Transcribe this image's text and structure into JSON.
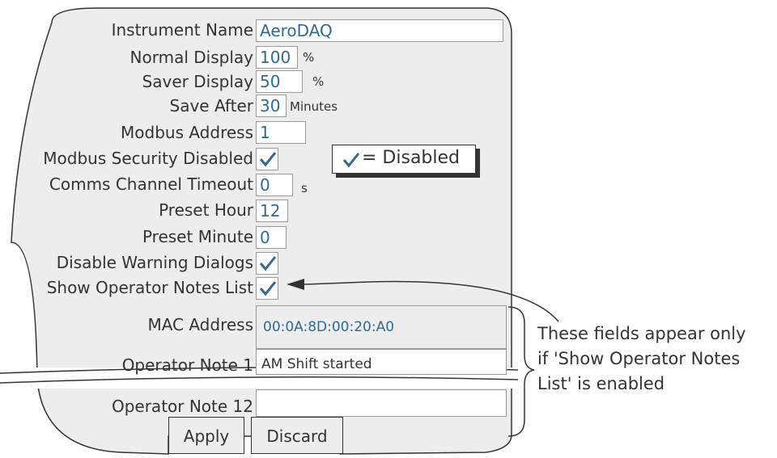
{
  "form": {
    "instrument_name": {
      "label": "Instrument Name",
      "value": "AeroDAQ"
    },
    "normal_display": {
      "label": "Normal Display",
      "value": "100",
      "unit": "%"
    },
    "saver_display": {
      "label": "Saver Display",
      "value": "50",
      "unit": "%"
    },
    "save_after": {
      "label": "Save After",
      "value": "30",
      "unit": "Minutes"
    },
    "modbus_address": {
      "label": "Modbus Address",
      "value": "1"
    },
    "modbus_security_disabled": {
      "label": "Modbus Security Disabled",
      "checked": true
    },
    "comms_channel_timeout": {
      "label": "Comms Channel Timeout",
      "value": "0",
      "unit": "s"
    },
    "preset_hour": {
      "label": "Preset Hour",
      "value": "12"
    },
    "preset_minute": {
      "label": "Preset Minute",
      "value": "0"
    },
    "disable_warning_dialogs": {
      "label": "Disable Warning Dialogs",
      "checked": true
    },
    "show_operator_notes_list": {
      "label": "Show Operator Notes List",
      "checked": true
    },
    "mac_address": {
      "label": "MAC Address",
      "value": "00:0A:8D:00:20:A0"
    },
    "operator_note_1": {
      "label": "Operator Note 1",
      "value": "AM Shift started"
    },
    "operator_note_12": {
      "label": "Operator Note 12",
      "value": ""
    }
  },
  "legend": {
    "text": "= Disabled"
  },
  "buttons": {
    "apply": "Apply",
    "discard": "Discard"
  },
  "annotation": {
    "lines": [
      "These fields appear only",
      "if 'Show Operator Notes",
      "List' is enabled"
    ]
  },
  "colors": {
    "panel": "#ededed",
    "value_text": "#2f6b8e",
    "outline": "#333333"
  }
}
